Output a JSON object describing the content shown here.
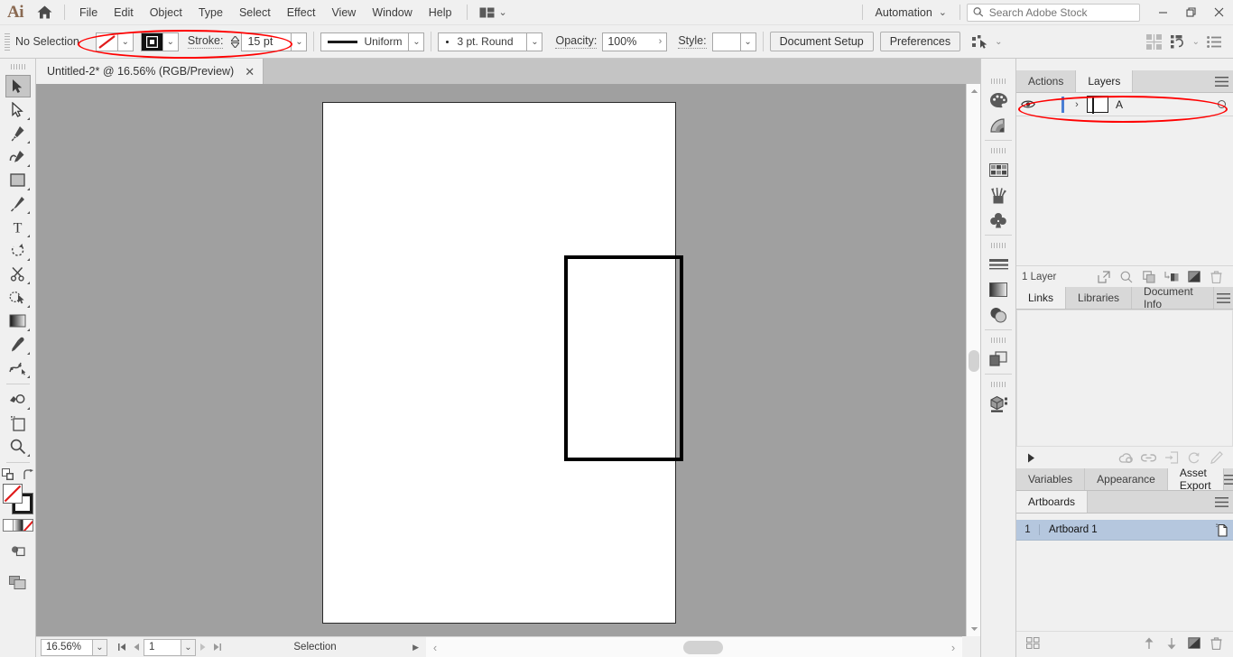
{
  "app": {
    "name": "Ai",
    "logo_text": "Ai"
  },
  "menubar": {
    "home_icon": "home-icon",
    "items": [
      "File",
      "Edit",
      "Object",
      "Type",
      "Select",
      "Effect",
      "View",
      "Window",
      "Help"
    ],
    "arrange_icon": "arrange-documents-icon",
    "arrange_caret": "⌄",
    "automation_label": "Automation",
    "automation_caret": "⌄",
    "search": {
      "icon": "search-icon",
      "placeholder": "Search Adobe Stock",
      "value": ""
    },
    "window_controls": {
      "minimize": "minimize-icon",
      "restore": "restore-icon",
      "close": "close-icon"
    }
  },
  "controlbar": {
    "selection_status": "No Selection",
    "fill_swatch": "none-fill-red-slash",
    "fill_caret": "⌄",
    "stroke_swatch": "black-stroke",
    "stroke_caret": "⌄",
    "stroke_label": "Stroke:",
    "stroke_weight": "15 pt",
    "stroke_weight_caret": "⌄",
    "variable_width_profile": "Uniform",
    "profile_caret": "⌄",
    "brush_definition": "3 pt. Round",
    "brush_caret": "⌄",
    "opacity_label": "Opacity:",
    "opacity_value": "100%",
    "opacity_caret": "›",
    "style_label": "Style:",
    "style_value": "",
    "style_caret": "⌄",
    "document_setup": "Document Setup",
    "preferences": "Preferences",
    "select_similar_icon": "select-similar-objects-icon",
    "select_similar_caret": "⌄",
    "align_icon": "align-icon",
    "transform_icon": "transform-icon",
    "transform_caret": "⌄",
    "options_icon": "panel-options-icon"
  },
  "tabbar": {
    "documents": [
      {
        "title": "Untitled-2* @ 16.56% (RGB/Preview)",
        "close": "✕",
        "active": true
      }
    ]
  },
  "toolbar": {
    "groups": [
      {
        "tools": [
          {
            "name": "selection-tool",
            "glyph": "cursor-arrow-filled",
            "active": true,
            "has_flyout": false
          },
          {
            "name": "direct-selection-tool",
            "glyph": "cursor-arrow-outline",
            "active": false,
            "has_flyout": true
          },
          {
            "name": "pen-tool",
            "glyph": "pen",
            "active": false,
            "has_flyout": true
          },
          {
            "name": "curvature-tool",
            "glyph": "curvature-pen",
            "active": false,
            "has_flyout": true
          },
          {
            "name": "rectangle-tool",
            "glyph": "rectangle",
            "active": false,
            "has_flyout": true
          },
          {
            "name": "paintbrush-tool",
            "glyph": "paintbrush",
            "active": false,
            "has_flyout": true
          },
          {
            "name": "type-tool",
            "glyph": "type-T",
            "active": false,
            "has_flyout": true
          },
          {
            "name": "rotate-tool",
            "glyph": "rotate-arrow",
            "active": false,
            "has_flyout": true
          },
          {
            "name": "scissors-tool",
            "glyph": "scissors",
            "active": false,
            "has_flyout": true
          },
          {
            "name": "shape-builder-tool",
            "glyph": "shape-builder",
            "active": false,
            "has_flyout": true
          },
          {
            "name": "gradient-tool",
            "glyph": "gradient-square",
            "active": false,
            "has_flyout": false
          },
          {
            "name": "eyedropper-tool",
            "glyph": "eyedropper",
            "active": false,
            "has_flyout": true
          },
          {
            "name": "blend-tool",
            "glyph": "blend",
            "active": false,
            "has_flyout": true
          },
          {
            "name": "symbol-sprayer-tool",
            "glyph": "symbol-sprayer",
            "active": false,
            "has_flyout": true
          },
          {
            "name": "artboard-tool",
            "glyph": "artboard",
            "active": false,
            "has_flyout": false
          },
          {
            "name": "zoom-tool",
            "glyph": "magnifier",
            "active": false,
            "has_flyout": true
          }
        ]
      }
    ],
    "bottom": {
      "default_fill_stroke_icon": "default-fill-stroke-icon",
      "swap_fill_stroke_icon": "swap-fill-stroke-icon",
      "fill_value": "None",
      "stroke_value": "Black",
      "color_modes": [
        "color-swatch",
        "gradient-swatch",
        "none-swatch"
      ],
      "drawing_mode_icon": "draw-normal-icon",
      "screen_mode_icon": "screen-mode-icon"
    }
  },
  "canvas": {
    "background_color": "#a0a0a0",
    "artboard": {
      "fill": "#ffffff",
      "label": "Artboard 1"
    },
    "artwork": [
      {
        "name": "rectangle-path",
        "type": "rectangle",
        "fill": "none",
        "stroke": "#000000",
        "stroke_weight": "15 pt"
      }
    ]
  },
  "statusbar": {
    "zoom_level": "16.56%",
    "zoom_caret": "⌄",
    "first_page_icon": "first-artboard-icon",
    "prev_page_icon": "prev-artboard-icon",
    "page_value": "1",
    "page_caret": "⌄",
    "next_page_icon": "next-artboard-icon",
    "last_page_icon": "last-artboard-icon",
    "status_text": "Selection",
    "status_caret": "▶",
    "scroll_left": "‹",
    "scroll_right": "›"
  },
  "dockstrip": {
    "collapse_icon": "«",
    "icons": [
      {
        "name": "color-panel-icon",
        "group": 0
      },
      {
        "name": "color-guide-panel-icon",
        "group": 0
      },
      {
        "name": "swatches-panel-icon",
        "group": 1
      },
      {
        "name": "brushes-panel-icon",
        "group": 1
      },
      {
        "name": "symbols-panel-icon",
        "group": 1
      },
      {
        "name": "stroke-panel-icon",
        "group": 2
      },
      {
        "name": "gradient-panel-icon",
        "group": 2
      },
      {
        "name": "transparency-panel-icon",
        "group": 2
      },
      {
        "name": "pathfinder-panel-icon",
        "group": 3
      },
      {
        "name": "3d-and-materials-panel-icon",
        "group": 4
      }
    ]
  },
  "panels": {
    "layers_group": {
      "tabs": [
        {
          "label": "Actions",
          "active": false
        },
        {
          "label": "Layers",
          "active": true
        }
      ],
      "menu_icon": "panel-menu-icon",
      "layers": [
        {
          "visibility_icon": "eye-icon",
          "lock_icon": "",
          "color": "#4a7fd4",
          "expand_icon": "›",
          "thumbnail": "layer-thumbnail",
          "name": "A",
          "target_icon": "target-circle-icon",
          "selected": true
        }
      ],
      "footer": {
        "count_label": "1 Layer",
        "icons": [
          "locate-object-icon",
          "search-icon",
          "make-clipping-mask-icon",
          "create-sublayer-icon",
          "create-new-layer-icon",
          "delete-selection-icon"
        ]
      }
    },
    "links_group": {
      "tabs": [
        {
          "label": "Links",
          "active": true
        },
        {
          "label": "Libraries",
          "active": false
        },
        {
          "label": "Document Info",
          "active": false
        }
      ],
      "menu_icon": "panel-menu-icon",
      "footer_icons": [
        "expand-arrow-icon",
        "cloud-link-icon",
        "relink-icon",
        "go-to-link-icon",
        "update-link-icon",
        "edit-original-icon"
      ]
    },
    "asset_group": {
      "tabs": [
        {
          "label": "Variables",
          "active": false
        },
        {
          "label": "Appearance",
          "active": false
        },
        {
          "label": "Asset Export",
          "active": true
        }
      ],
      "menu_icon": "panel-menu-icon"
    },
    "artboards_group": {
      "tabs": [
        {
          "label": "Artboards",
          "active": true
        }
      ],
      "menu_icon": "panel-menu-icon",
      "rows": [
        {
          "number": "1",
          "name": "Artboard 1",
          "icon": "artboard-options-icon",
          "selected": true
        }
      ],
      "footer_icons": [
        "rearrange-artboards-icon",
        "move-up-icon",
        "move-down-icon",
        "new-artboard-icon",
        "delete-artboard-icon"
      ]
    }
  },
  "annotations": [
    {
      "name": "stroke-controls-highlight",
      "shape": "ellipse",
      "color": "#ff0000"
    },
    {
      "name": "layer-row-highlight",
      "shape": "ellipse",
      "color": "#ff0000"
    }
  ]
}
